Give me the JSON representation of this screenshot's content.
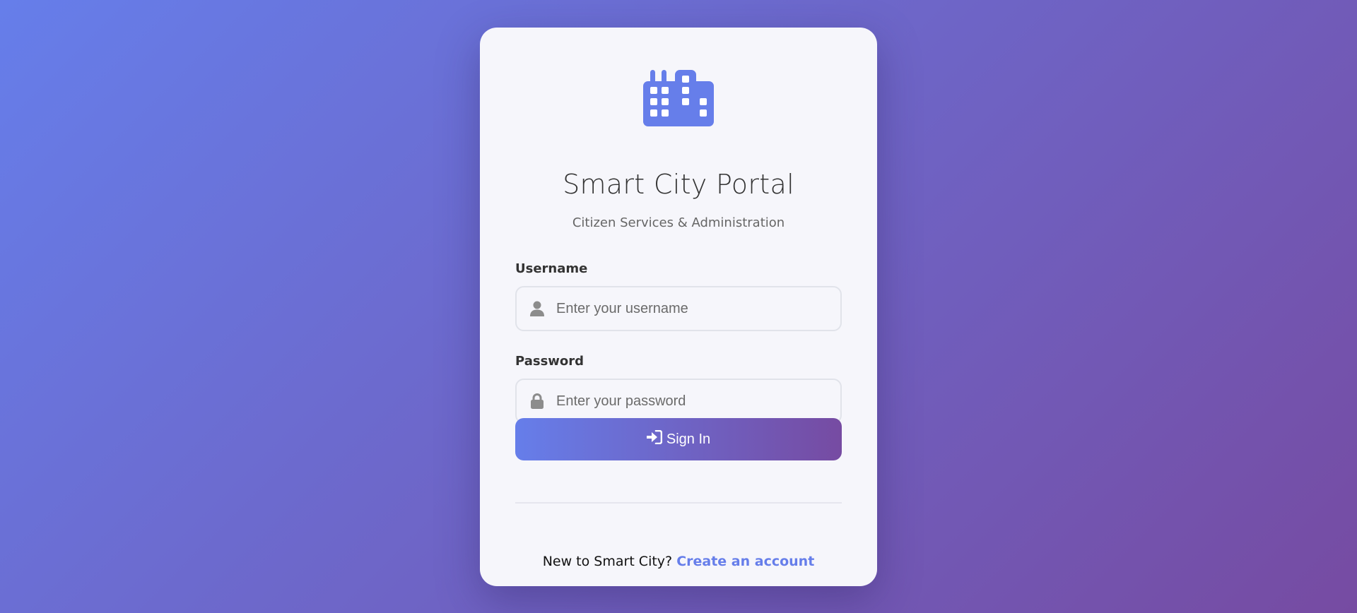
{
  "colors": {
    "gradient_start": "#667eea",
    "gradient_end": "#764ba2",
    "accent": "#667eea",
    "card_bg": "#f6f6fb"
  },
  "header": {
    "logo_icon": "city-building-icon",
    "title": "Smart City Portal",
    "subtitle": "Citizen Services & Administration"
  },
  "form": {
    "username": {
      "label": "Username",
      "placeholder": "Enter your username",
      "value": "",
      "icon": "user-icon"
    },
    "password": {
      "label": "Password",
      "placeholder": "Enter your password",
      "value": "",
      "icon": "lock-icon"
    },
    "submit": {
      "label": "Sign In",
      "icon": "sign-in-icon"
    }
  },
  "footer": {
    "prompt": "New to Smart City?",
    "link_label": "Create an account"
  }
}
